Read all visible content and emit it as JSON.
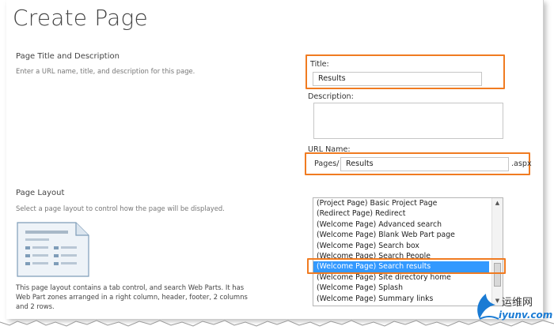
{
  "page": {
    "title": "Create Page"
  },
  "title_section": {
    "heading": "Page Title and Description",
    "description": "Enter a URL name, title, and description for this page.",
    "title_label": "Title:",
    "title_value": "Results",
    "description_label": "Description:",
    "url_label": "URL Name:",
    "url_prefix": "Pages/",
    "url_value": "Results",
    "url_suffix": ".aspx"
  },
  "layout_section": {
    "heading": "Page Layout",
    "description": "Select a page layout to control how the page will be displayed.",
    "layout_description": "This page layout contains a tab control, and search Web Parts. It has Web Part zones arranged in a right column, header, footer, 2 columns and 2 rows.",
    "options": [
      "(Project Page) Basic Project Page",
      "(Redirect Page) Redirect",
      "(Welcome Page) Advanced search",
      "(Welcome Page) Blank Web Part page",
      "(Welcome Page) Search box",
      "(Welcome Page) Search People",
      "(Welcome Page) Search results",
      "(Welcome Page) Site directory home",
      "(Welcome Page) Splash",
      "(Welcome Page) Summary links"
    ],
    "selected_index": 6
  },
  "watermark": {
    "text": "运维网",
    "url": "iyunv.com"
  },
  "colors": {
    "highlight": "#f07b21",
    "selection": "#3399ff"
  }
}
